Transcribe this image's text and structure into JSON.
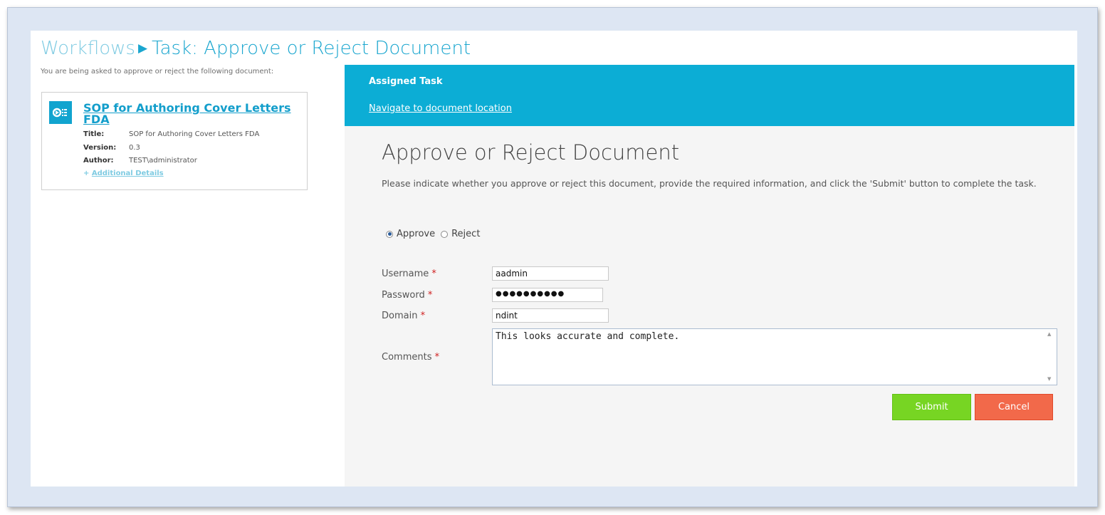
{
  "breadcrumb": {
    "parent": "Workflows",
    "separator": "▶",
    "current": "Task: Approve or Reject Document"
  },
  "intro_text": "You are being asked to approve or reject the following document:",
  "document": {
    "name": "SOP for Authoring Cover Letters FDA",
    "title_label": "Title:",
    "title_value": "SOP for Authoring Cover Letters FDA",
    "version_label": "Version:",
    "version_value": "0.3",
    "author_label": "Author:",
    "author_value": "TEST\\administrator",
    "more_prefix": "+",
    "more_link": "Additional Details"
  },
  "task": {
    "header_label": "Assigned Task",
    "nav_link": "Navigate to document location"
  },
  "form": {
    "title": "Approve or Reject Document",
    "description": "Please indicate whether you approve or reject this document, provide the required information, and click the 'Submit' button to complete the task.",
    "options": [
      "Approve",
      "Reject"
    ],
    "selected_option": "Approve",
    "username_label": "Username",
    "username_value": "aadmin",
    "password_label": "Password",
    "password_value": "●●●●●●●●●●",
    "domain_label": "Domain",
    "domain_value": "ndint",
    "comments_label": "Comments",
    "comments_value": "This looks accurate and complete.",
    "required_marker": "*",
    "submit_label": "Submit",
    "cancel_label": "Cancel"
  },
  "colors": {
    "accent": "#0cadd5",
    "submit": "#77d523",
    "cancel": "#f2694a",
    "required": "#d02020"
  }
}
